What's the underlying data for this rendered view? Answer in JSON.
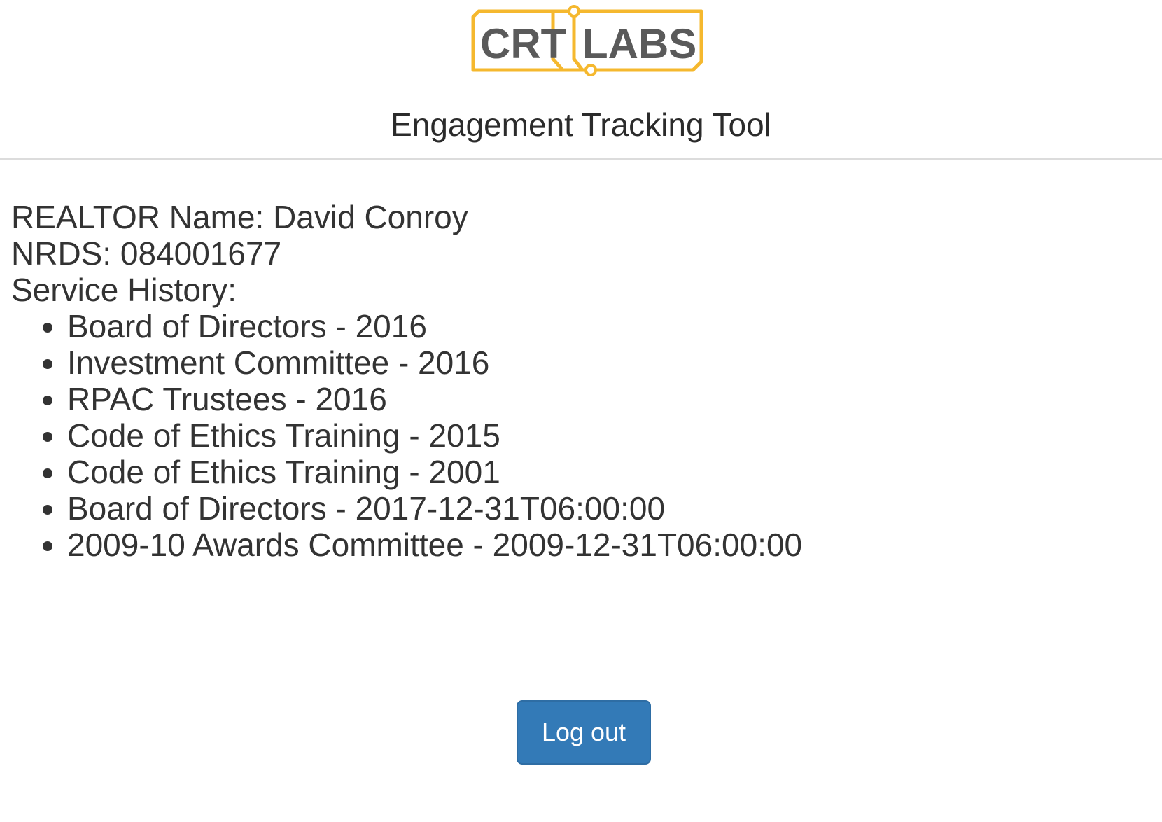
{
  "header": {
    "logo": {
      "left_text": "CRT",
      "right_text": "LABS",
      "accent_color": "#f5b82e",
      "text_color": "#5a5a5a"
    },
    "app_title": "Engagement Tracking Tool"
  },
  "profile": {
    "realtor_name": "REALTOR Name: David Conroy",
    "nrds": "NRDS: 084001677",
    "service_history_label": "Service History:",
    "service_history": [
      "Board of Directors - 2016",
      "Investment Committee - 2016",
      "RPAC Trustees - 2016",
      "Code of Ethics Training - 2015",
      "Code of Ethics Training - 2001",
      "Board of Directors - 2017-12-31T06:00:00",
      "2009-10 Awards Committee - 2009-12-31T06:00:00"
    ]
  },
  "actions": {
    "logout_label": "Log out",
    "button_color": "#337ab7"
  }
}
